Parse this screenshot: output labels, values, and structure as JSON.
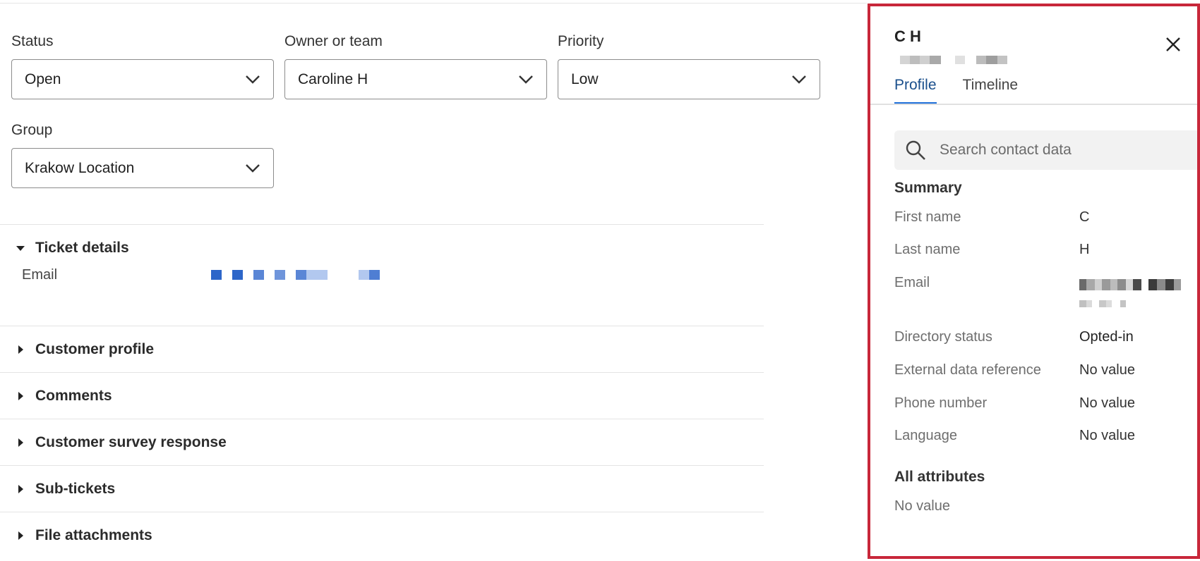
{
  "form": {
    "status": {
      "label": "Status",
      "value": "Open"
    },
    "owner": {
      "label": "Owner or team",
      "value": "Caroline H"
    },
    "priority": {
      "label": "Priority",
      "value": "Low"
    },
    "group": {
      "label": "Group",
      "value": "Krakow Location"
    }
  },
  "sections": {
    "ticket_details": {
      "title": "Ticket details",
      "email_label": "Email"
    },
    "items": [
      {
        "title": "Customer profile"
      },
      {
        "title": "Comments"
      },
      {
        "title": "Customer survey response"
      },
      {
        "title": "Sub-tickets"
      },
      {
        "title": "File attachments"
      }
    ]
  },
  "panel": {
    "title": "C H",
    "tabs": [
      "Profile",
      "Timeline"
    ],
    "active_tab": "Profile",
    "search_placeholder": "Search contact data",
    "summary_heading": "Summary",
    "rows": [
      {
        "key": "First name",
        "value": "C"
      },
      {
        "key": "Last name",
        "value": "H"
      },
      {
        "key": "Email",
        "value": ""
      },
      {
        "key": "Directory status",
        "value": "Opted-in"
      },
      {
        "key": "External data reference",
        "value": "No value"
      },
      {
        "key": "Phone number",
        "value": "No value"
      },
      {
        "key": "Language",
        "value": "No value"
      }
    ],
    "all_attributes_heading": "All attributes",
    "all_attributes_value": "No value"
  },
  "colors": {
    "panel_border": "#c8273a",
    "tab_accent": "#1e6fd9",
    "link_blue": "#2d66c9"
  },
  "icons": {
    "dropdown": "chevron-down-icon",
    "expanded": "caret-down-icon",
    "collapsed": "caret-right-icon",
    "close": "close-icon",
    "search": "search-icon"
  }
}
